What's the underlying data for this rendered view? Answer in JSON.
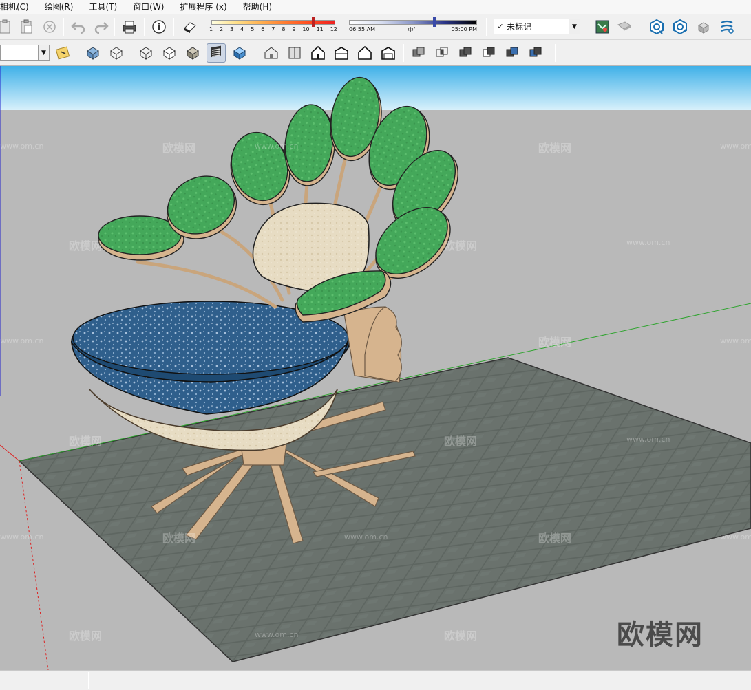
{
  "menu": {
    "items": [
      "相机(C)",
      "绘图(R)",
      "工具(T)",
      "窗口(W)",
      "扩展程序 (x)",
      "帮助(H)"
    ]
  },
  "shadow_slider": {
    "ticks": [
      "1",
      "2",
      "3",
      "4",
      "5",
      "6",
      "7",
      "8",
      "9",
      "10",
      "11",
      "12"
    ],
    "value_month": 11
  },
  "time_slider": {
    "start_label": "06:55 AM",
    "mid_label": "中午",
    "end_label": "05:00 PM"
  },
  "tag_dropdown": {
    "check": "✓",
    "value": "未标记"
  },
  "watermarks": {
    "brand": "欧模网",
    "url": "www.om.cn"
  },
  "colors": {
    "sky_top": "#3fb0e8",
    "sky_bottom": "#d8f0fb",
    "ground": "#b7b7b7",
    "rug": "#5d6560",
    "leaf": "#44a85a",
    "wood": "#d6b48e",
    "seat": "#2f5f8c"
  }
}
